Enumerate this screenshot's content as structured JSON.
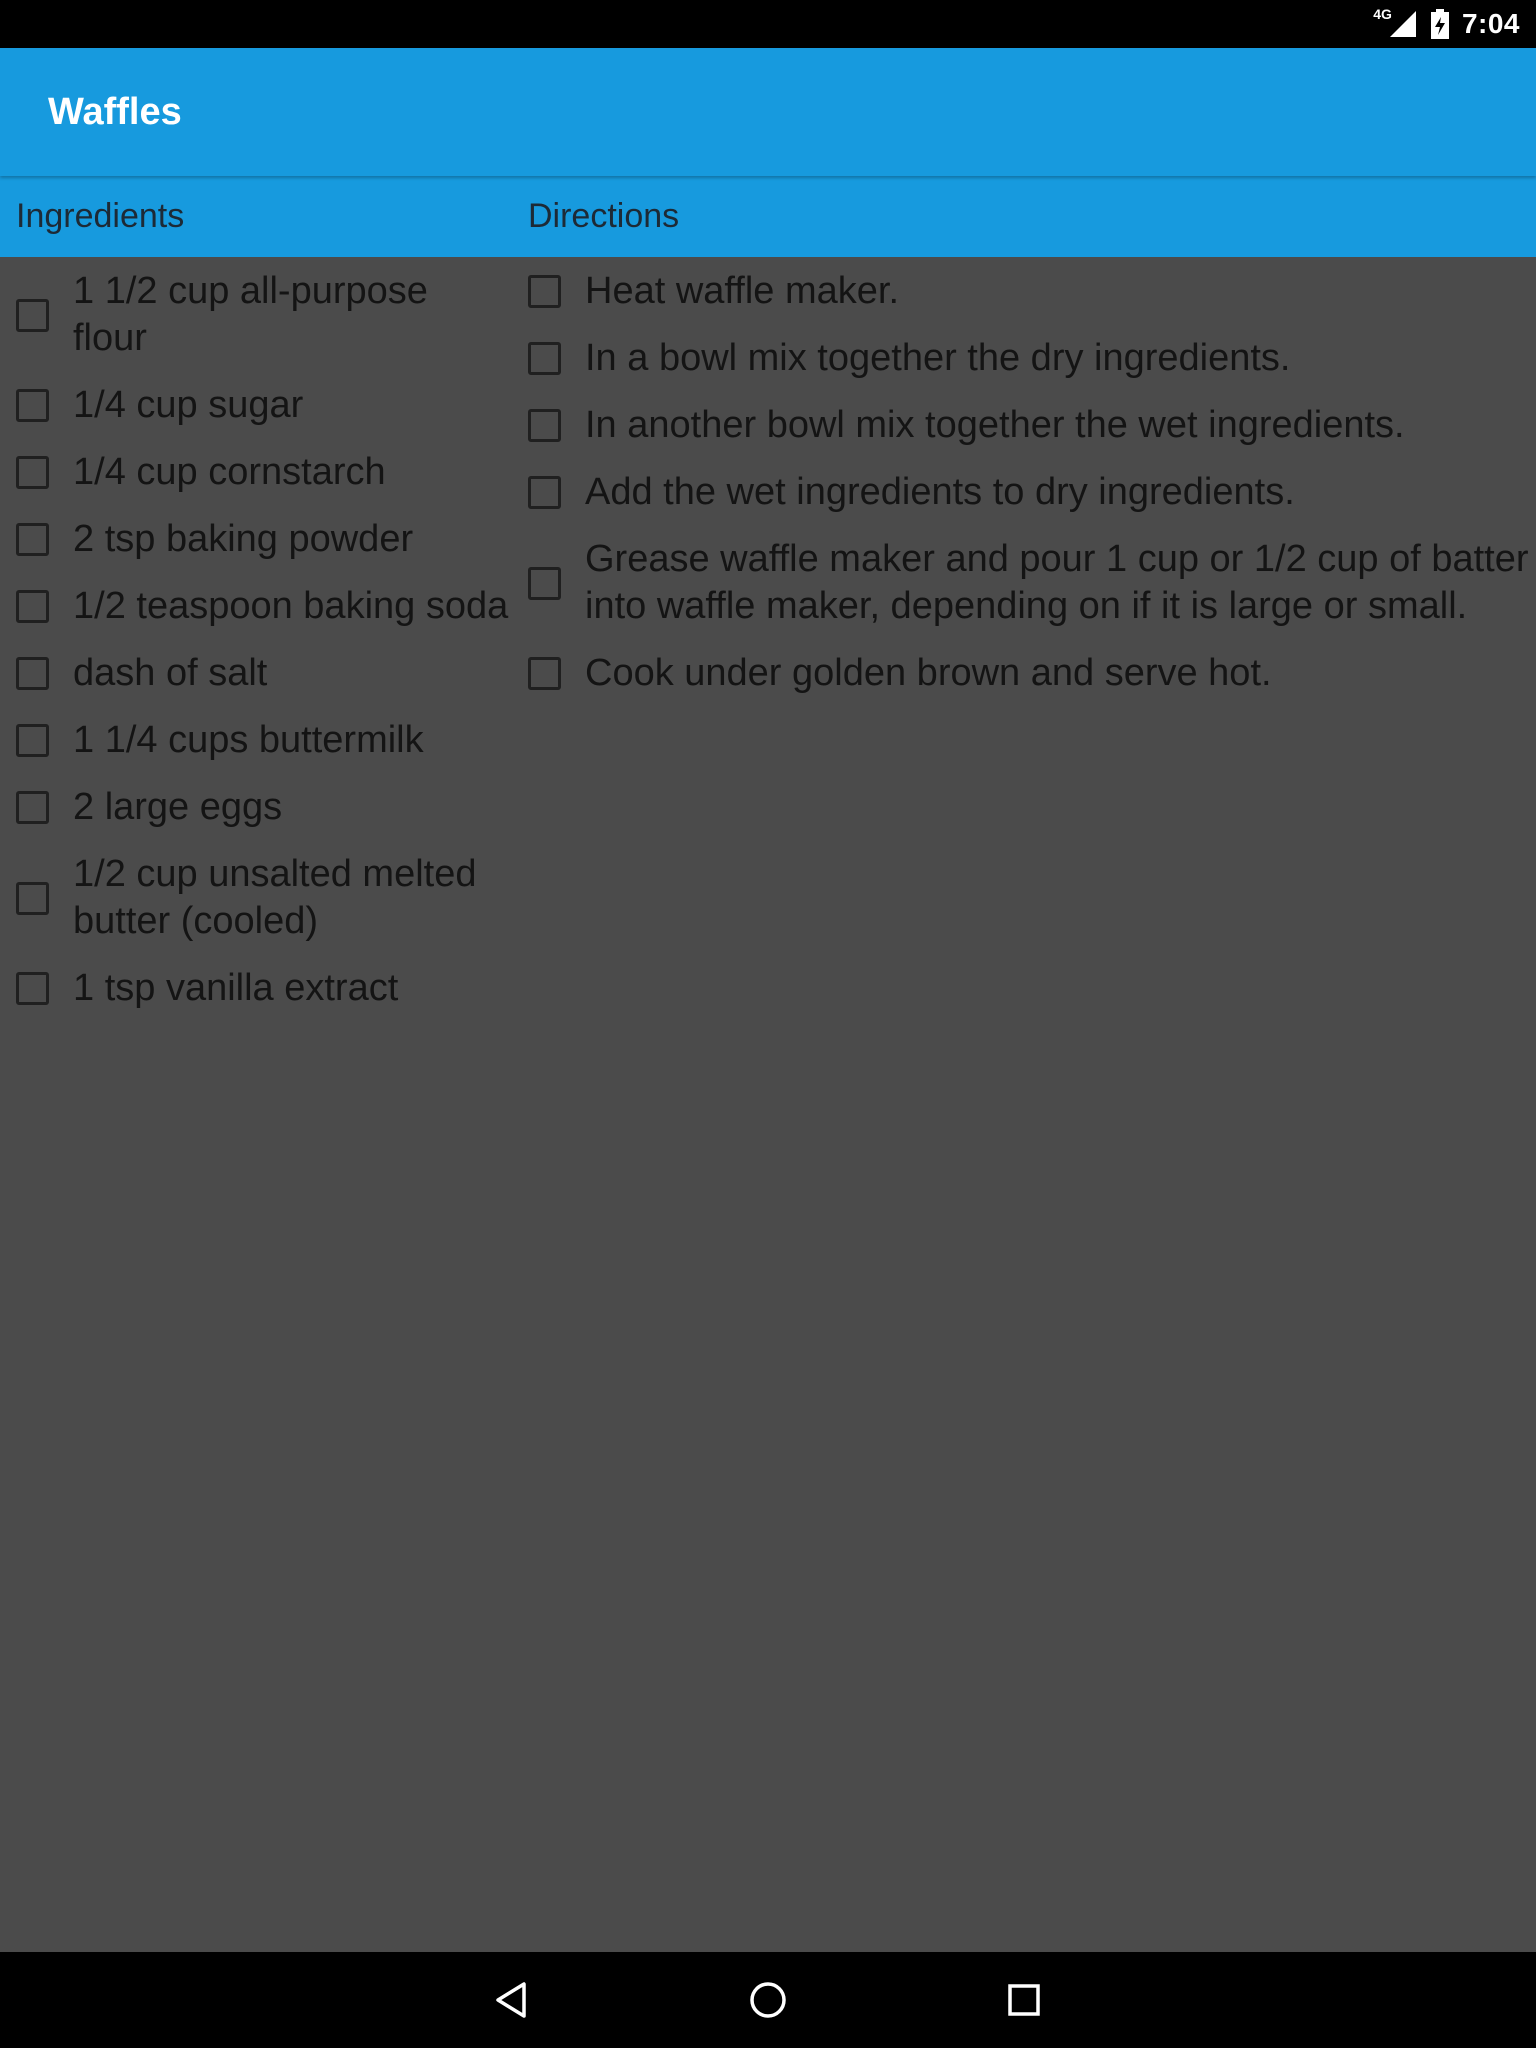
{
  "status_bar": {
    "network_type": "4G",
    "time": "7:04",
    "icons": [
      "signal-icon",
      "battery-icon"
    ]
  },
  "app_bar": {
    "title": "Waffles"
  },
  "columns": {
    "ingredients_label": "Ingredients",
    "directions_label": "Directions"
  },
  "ingredients": [
    {
      "text": "1 1/2 cup all-purpose flour",
      "checked": false
    },
    {
      "text": "1/4 cup sugar",
      "checked": false
    },
    {
      "text": "1/4 cup cornstarch",
      "checked": false
    },
    {
      "text": "2 tsp baking powder",
      "checked": false
    },
    {
      "text": "1/2 teaspoon baking soda",
      "checked": false
    },
    {
      "text": "dash of salt",
      "checked": false
    },
    {
      "text": "1 1/4 cups buttermilk",
      "checked": false
    },
    {
      "text": "2 large eggs",
      "checked": false
    },
    {
      "text": "1/2 cup unsalted melted butter (cooled)",
      "checked": false
    },
    {
      "text": "1 tsp vanilla extract",
      "checked": false
    }
  ],
  "directions": [
    {
      "text": "Heat waffle maker.",
      "checked": false
    },
    {
      "text": "In a bowl mix together the dry ingredients.",
      "checked": false
    },
    {
      "text": "In another bowl mix together the wet ingredients.",
      "checked": false
    },
    {
      "text": "Add the wet ingredients to dry ingredients.",
      "checked": false
    },
    {
      "text": "Grease waffle maker and pour 1 cup or 1/2 cup of batter into waffle maker, depending on if it is large or small.",
      "checked": false
    },
    {
      "text": "Cook under golden brown and serve hot.",
      "checked": false
    }
  ],
  "nav_bar": {
    "icons": [
      "back-icon",
      "home-icon",
      "recents-icon"
    ]
  },
  "colors": {
    "primary": "#179ade",
    "background": "#4b4b4b",
    "text": "#141414",
    "status_bar": "#000000"
  }
}
